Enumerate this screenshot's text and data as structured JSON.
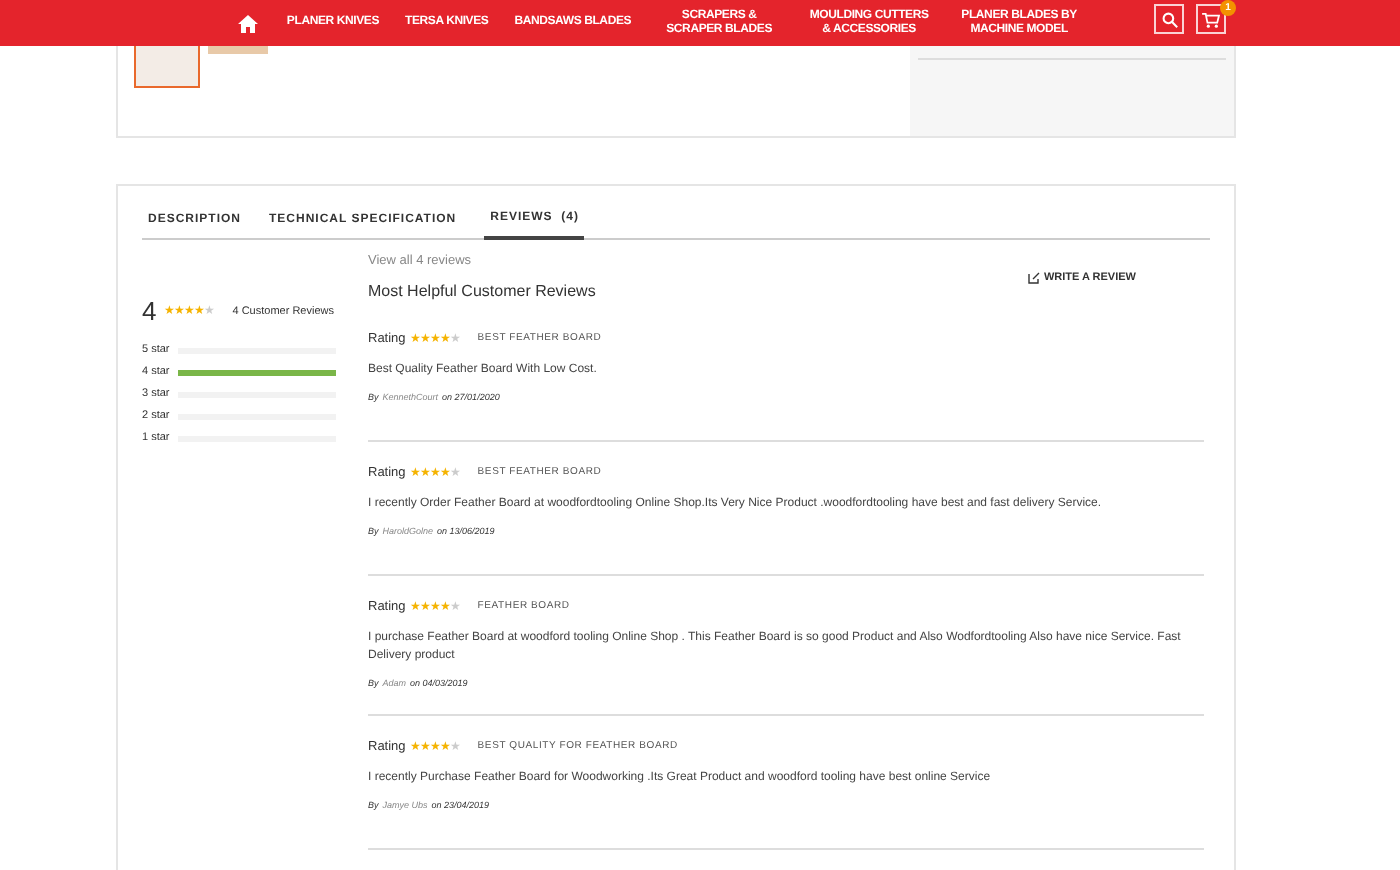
{
  "nav": {
    "items": [
      {
        "label": "PLANER KNIVES"
      },
      {
        "label": "TERSA KNIVES"
      },
      {
        "label": "BANDSAWS BLADES"
      },
      {
        "label": "SCRAPERS & SCRAPER BLADES"
      },
      {
        "label": "MOULDING CUTTERS & ACCESSORIES"
      },
      {
        "label": "PLANER BLADES BY MACHINE MODEL"
      }
    ],
    "cart_count": "1"
  },
  "tabs": [
    {
      "label": "DESCRIPTION",
      "selected": false
    },
    {
      "label": "TECHNICAL SPECIFICATION",
      "selected": false
    },
    {
      "label": "REVIEWS  (4)",
      "selected": true
    }
  ],
  "summary": {
    "average": "4",
    "stars": 4,
    "count_label": "4 Customer Reviews",
    "breakdown": [
      {
        "label": "5 star",
        "level": 0
      },
      {
        "label": "4 star",
        "level": 1
      },
      {
        "label": "3 star",
        "level": 0
      },
      {
        "label": "2 star",
        "level": 0
      },
      {
        "label": "1 star",
        "level": 0
      }
    ]
  },
  "view_all": "View all 4 reviews",
  "heading": "Most Helpful Customer Reviews",
  "write_review": "WRITE A REVIEW",
  "reviews": [
    {
      "rating_label": "Rating",
      "stars": 4,
      "title": "BEST FEATHER BOARD",
      "text": "Best Quality Feather Board With Low Cost.",
      "by": "By",
      "author": "KennethCourt",
      "on": "on 27/01/2020"
    },
    {
      "rating_label": "Rating",
      "stars": 4,
      "title": "BEST FEATHER BOARD",
      "text": "I recently Order Feather Board at woodfordtooling Online Shop.Its Very Nice Product .woodfordtooling have best and fast delivery Service.",
      "by": "By",
      "author": "HaroldGolne",
      "on": "on 13/06/2019"
    },
    {
      "rating_label": "Rating",
      "stars": 4,
      "title": "FEATHER BOARD",
      "text": "I purchase Feather Board at woodford tooling Online Shop . This Feather Board is so good Product and Also Wodfordtooling Also have nice Service. Fast Delivery product",
      "by": "By",
      "author": "Adam",
      "on": "on 04/03/2019"
    },
    {
      "rating_label": "Rating",
      "stars": 4,
      "title": "BEST QUALITY FOR FEATHER BOARD",
      "text": "I recently Purchase Feather Board for Woodworking .Its Great Product and woodford tooling have best online Service",
      "by": "By",
      "author": "Jamye Ubs",
      "on": "on 23/04/2019"
    }
  ]
}
